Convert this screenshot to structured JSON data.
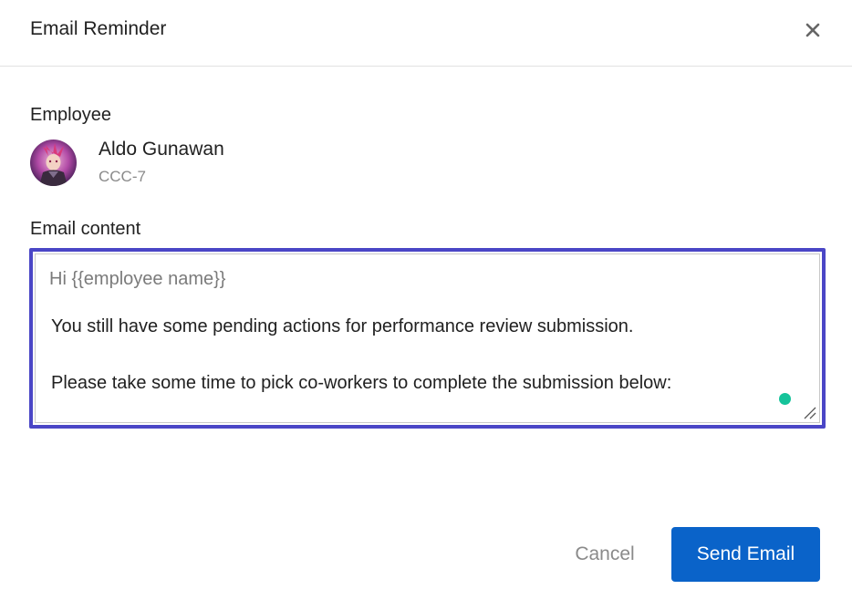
{
  "dialog": {
    "title": "Email Reminder",
    "close_icon": "close-icon"
  },
  "employee": {
    "section_label": "Employee",
    "name": "Aldo Gunawan",
    "id": "CCC-7",
    "avatar_icon": "avatar-image"
  },
  "email": {
    "section_label": "Email content",
    "greeting": "Hi {{employee name}}",
    "line_1": "You still have some pending actions for performance review submission.",
    "line_2": "Please take some time to pick co-workers to complete the submission below:",
    "focus_color": "#4a46c6",
    "grammar_indicator_color": "#15c39a"
  },
  "actions": {
    "cancel_label": "Cancel",
    "send_label": "Send Email",
    "send_color": "#0a63c9"
  }
}
